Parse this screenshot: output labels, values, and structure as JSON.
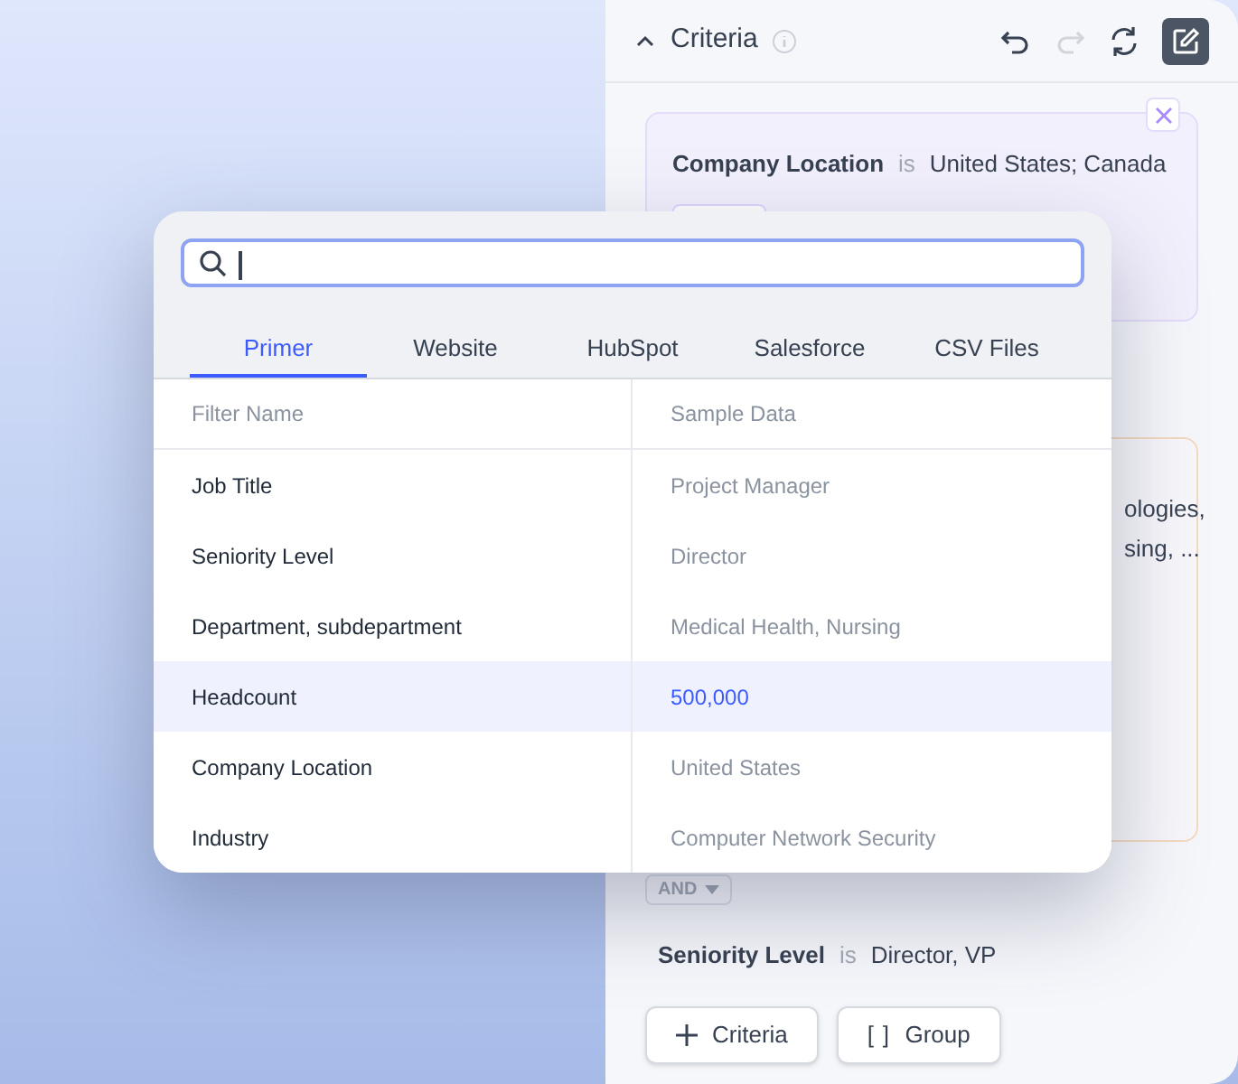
{
  "panel": {
    "title": "Criteria",
    "actions": [
      {
        "kind": "undo",
        "disabled": false
      },
      {
        "kind": "redo",
        "disabled": true
      },
      {
        "kind": "refresh",
        "disabled": false
      },
      {
        "kind": "edit",
        "disabled": false
      }
    ]
  },
  "criteria_cards": [
    {
      "kind": "location",
      "field": "Company Location",
      "operator": "is",
      "value": "United States; Canada"
    },
    {
      "kind": "industry",
      "lines": [
        "ologies,",
        "sing, ..."
      ]
    }
  ],
  "connector": {
    "label": "AND"
  },
  "seniority": {
    "field": "Seniority Level",
    "operator": "is",
    "value": "Director, VP"
  },
  "buttons": [
    {
      "kind": "plus",
      "label": "Criteria"
    },
    {
      "kind": "bracket",
      "icon": "[ ]",
      "label": "Group"
    }
  ],
  "popup": {
    "tabs": [
      {
        "label": "Primer",
        "selected": true
      },
      {
        "label": "Website",
        "selected": false
      },
      {
        "label": "HubSpot",
        "selected": false
      },
      {
        "label": "Salesforce",
        "selected": false
      },
      {
        "label": "CSV Files",
        "selected": false
      }
    ],
    "columns": [
      "Filter Name",
      "Sample Data"
    ],
    "rows": [
      {
        "name": "Job Title",
        "sample": "Project Manager",
        "selected": false
      },
      {
        "name": "Seniority Level",
        "sample": "Director",
        "selected": false
      },
      {
        "name": "Department, subdepartment",
        "sample": "Medical Health, Nursing",
        "selected": false
      },
      {
        "name": "Headcount",
        "sample": "500,000",
        "selected": true
      },
      {
        "name": "Company Location",
        "sample": "United States",
        "selected": false
      },
      {
        "name": "Industry",
        "sample": "Computer Network Security",
        "selected": false
      }
    ]
  }
}
